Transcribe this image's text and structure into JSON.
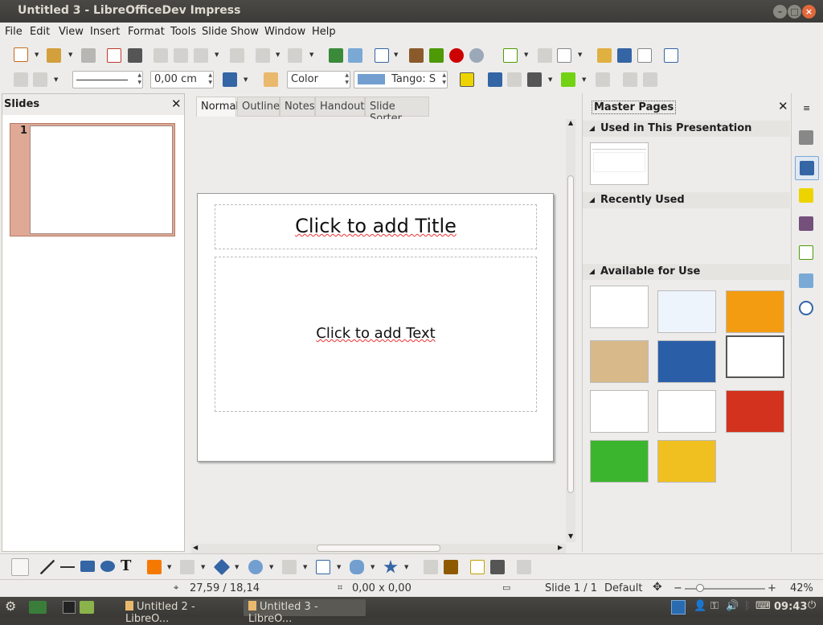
{
  "window": {
    "title": "Untitled 3 - LibreOfficeDev Impress"
  },
  "menu": [
    "File",
    "Edit",
    "View",
    "Insert",
    "Format",
    "Tools",
    "Slide Show",
    "Window",
    "Help"
  ],
  "toolbar2": {
    "line_width": "0,00 cm",
    "area_style": "Color",
    "area_color_name": "Tango: S",
    "area_color": "#729fcf"
  },
  "slides_pane": {
    "title": "Slides",
    "slide_number": "1"
  },
  "view_tabs": [
    "Normal",
    "Outline",
    "Notes",
    "Handout",
    "Slide Sorter"
  ],
  "slide": {
    "title_placeholder": "Click to add Title",
    "text_placeholder": "Click to add Text"
  },
  "master_pages": {
    "title": "Master Pages",
    "used_section": "Used in This Presentation",
    "recent_section": "Recently Used",
    "available_section": "Available for Use",
    "used": [
      {
        "bg": "#ffffff"
      }
    ],
    "available": [
      {
        "bg": "#ffffff"
      },
      {
        "bg": "#eef4fb"
      },
      {
        "bg": "#f39c12"
      },
      {
        "bg": "#d8b98a"
      },
      {
        "bg": "#2a5fa8"
      },
      {
        "bg": "#ffffff"
      },
      {
        "bg": "#ffffff"
      },
      {
        "bg": "#ffffff"
      },
      {
        "bg": "#d2321e"
      },
      {
        "bg": "#3cb52e"
      },
      {
        "bg": "#f0c020"
      }
    ]
  },
  "status": {
    "position": "27,59 / 18,14",
    "size": "0,00 x 0,00",
    "slide": "Slide 1 / 1",
    "master": "Default",
    "zoom": "42%"
  },
  "taskbar": {
    "task1": "Untitled 2 - LibreO...",
    "task2": "Untitled 3 - LibreO...",
    "clock": "09:43"
  }
}
